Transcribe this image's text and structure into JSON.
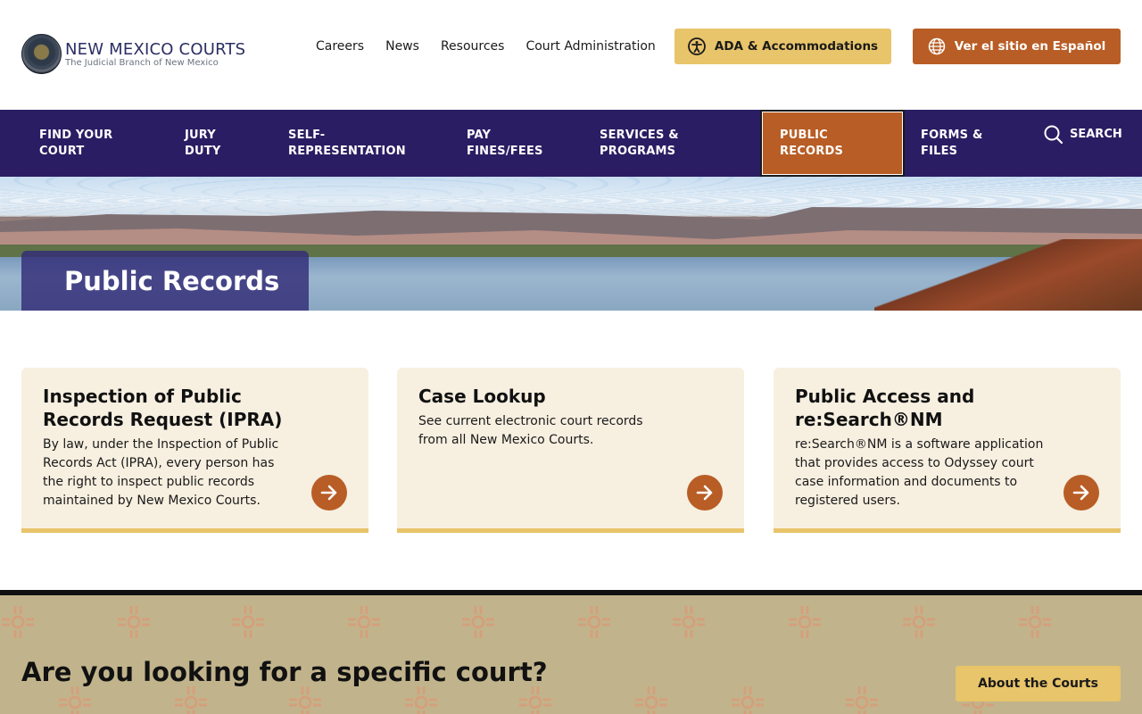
{
  "header": {
    "logo_title": "NEW MEXICO COURTS",
    "logo_subtitle": "The Judicial Branch of New Mexico",
    "links": [
      "Careers",
      "News",
      "Resources",
      "Court Administration"
    ],
    "ada_button": "ADA & Accommodations",
    "spanish_button": "Ver el sitio en Español"
  },
  "nav": {
    "items": [
      {
        "line1": "FIND YOUR",
        "line2": "COURT"
      },
      {
        "line1": "JURY",
        "line2": "DUTY"
      },
      {
        "line1": "SELF-",
        "line2": "REPRESENTATION"
      },
      {
        "line1": "PAY",
        "line2": "FINES/FEES"
      },
      {
        "line1": "SERVICES &",
        "line2": "PROGRAMS"
      },
      {
        "line1": "PUBLIC",
        "line2": "RECORDS"
      },
      {
        "line1": "FORMS &",
        "line2": "FILES"
      }
    ],
    "active_index": 5,
    "search_label": "SEARCH"
  },
  "hero": {
    "title": "Public Records"
  },
  "cards": [
    {
      "title": "Inspection of Public Records Request (IPRA)",
      "description": "By law, under the Inspection of Public Records Act (IPRA), every person has the right to inspect public records maintained by New Mexico Courts."
    },
    {
      "title": "Case Lookup",
      "description": "See current electronic court records from all New Mexico Courts."
    },
    {
      "title": "Public Access and re:Search®NM",
      "description": "re:Search®NM is a software application that provides access to Odyssey court case information and documents to registered users."
    }
  ],
  "band": {
    "heading": "Are you looking for a specific court?",
    "button": "About the Courts"
  },
  "colors": {
    "nav_bg": "#2b1d63",
    "accent_orange": "#b85d25",
    "accent_gold": "#e8c46a",
    "card_bg": "#f7efe0",
    "band_bg": "#c1b48c"
  }
}
